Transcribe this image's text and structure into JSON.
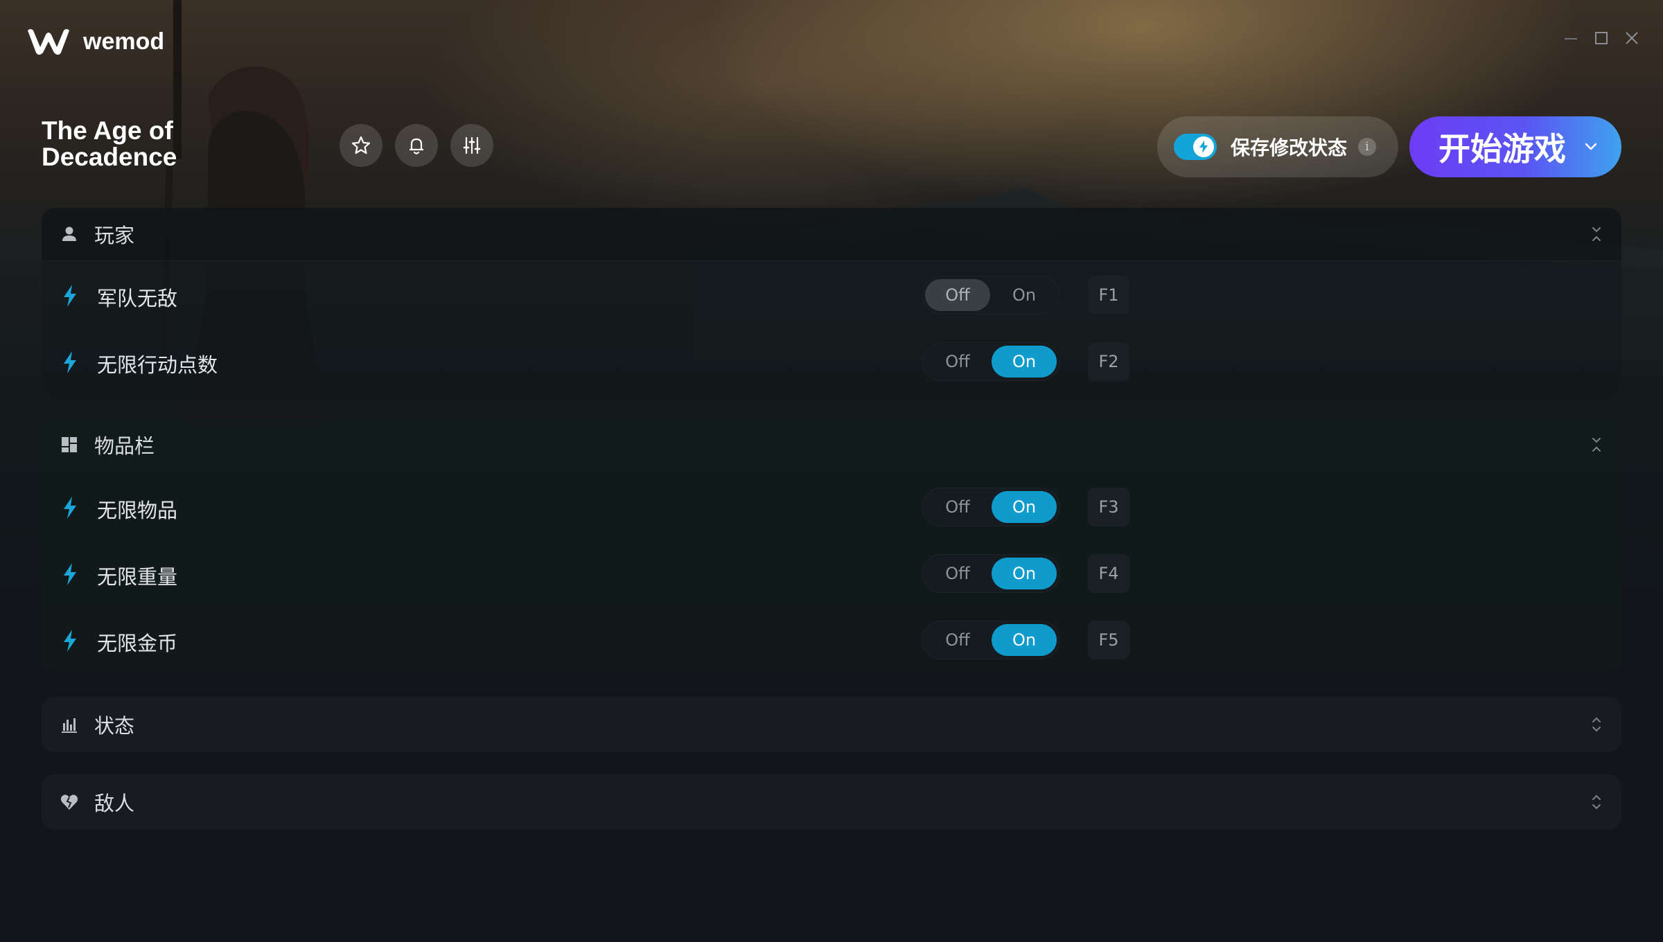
{
  "app": {
    "name": "wemod"
  },
  "game": {
    "title": "The Age of Decadence"
  },
  "header_icons": [
    "star-icon",
    "bell-icon",
    "sliders-icon"
  ],
  "save_mods": {
    "label": "保存修改状态",
    "enabled": true,
    "info": "i"
  },
  "play": {
    "label": "开始游戏"
  },
  "toggle_labels": {
    "off": "Off",
    "on": "On"
  },
  "sections": [
    {
      "title": "玩家",
      "icon": "user-icon",
      "expanded": true,
      "items": [
        {
          "name": "军队无敌",
          "state": "off",
          "hotkey": "F1"
        },
        {
          "name": "无限行动点数",
          "state": "on",
          "hotkey": "F2"
        }
      ]
    },
    {
      "title": "物品栏",
      "icon": "inventory-icon",
      "expanded": true,
      "items": [
        {
          "name": "无限物品",
          "state": "on",
          "hotkey": "F3"
        },
        {
          "name": "无限重量",
          "state": "on",
          "hotkey": "F4"
        },
        {
          "name": "无限金币",
          "state": "on",
          "hotkey": "F5"
        }
      ]
    },
    {
      "title": "状态",
      "icon": "stats-icon",
      "expanded": false,
      "items": []
    },
    {
      "title": "敌人",
      "icon": "broken-heart-icon",
      "expanded": false,
      "items": []
    }
  ],
  "colors": {
    "accent": "#0f9ccc",
    "play_start": "#6d3cf5",
    "play_end": "#3fa2ee",
    "bolt": "#1aa6d9"
  }
}
